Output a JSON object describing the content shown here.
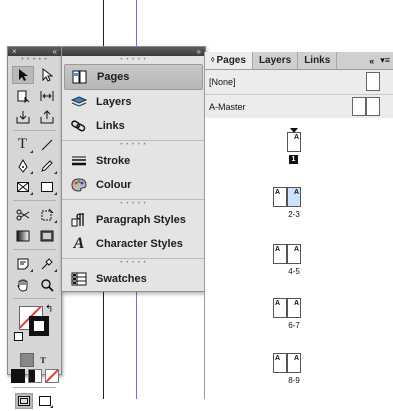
{
  "toolbox": {
    "close": "×",
    "collapse": "«",
    "tools": [
      [
        "selection-tool",
        "direct-selection-tool"
      ],
      [
        "page-tool",
        "gap-tool"
      ],
      [
        "content-collector-tool",
        "content-placer-tool"
      ],
      [
        "type-tool",
        "line-tool"
      ],
      [
        "pen-tool",
        "pencil-tool"
      ],
      [
        "rectangle-frame-tool",
        "rectangle-tool"
      ],
      [
        "scissors-tool",
        "free-transform-tool"
      ],
      [
        "gradient-swatch-tool",
        "gradient-feather-tool"
      ],
      [
        "note-tool",
        "eyedropper-tool"
      ],
      [
        "hand-tool",
        "zoom-tool"
      ]
    ],
    "formatting_text_label": "T"
  },
  "dock": {
    "expand": "»",
    "groups": [
      [
        {
          "label": "Pages",
          "icon": "pages-icon",
          "active": true
        },
        {
          "label": "Layers",
          "icon": "layers-icon"
        },
        {
          "label": "Links",
          "icon": "links-icon"
        }
      ],
      [
        {
          "label": "Stroke",
          "icon": "stroke-icon"
        },
        {
          "label": "Colour",
          "icon": "colour-icon"
        }
      ],
      [
        {
          "label": "Paragraph Styles",
          "icon": "paragraph-styles-icon"
        },
        {
          "label": "Character Styles",
          "icon": "character-styles-icon"
        }
      ],
      [
        {
          "label": "Swatches",
          "icon": "swatches-icon"
        }
      ]
    ]
  },
  "pages_panel": {
    "tabs": [
      "Pages",
      "Layers",
      "Links"
    ],
    "active_tab": "Pages",
    "collapse": "«",
    "masters": [
      {
        "label": "[None]"
      },
      {
        "label": "A-Master"
      }
    ],
    "spreads": [
      {
        "label": "",
        "badge": "1",
        "master": "A"
      },
      {
        "label": "2-3",
        "master": "A"
      },
      {
        "label": "4-5",
        "master": "A"
      },
      {
        "label": "6-7",
        "master": "A"
      },
      {
        "label": "8-9",
        "master": "A"
      }
    ]
  },
  "colors": {
    "selected_page": "#cfe2fb",
    "guide": "#8b5cf6",
    "no_color": "#e53935"
  }
}
